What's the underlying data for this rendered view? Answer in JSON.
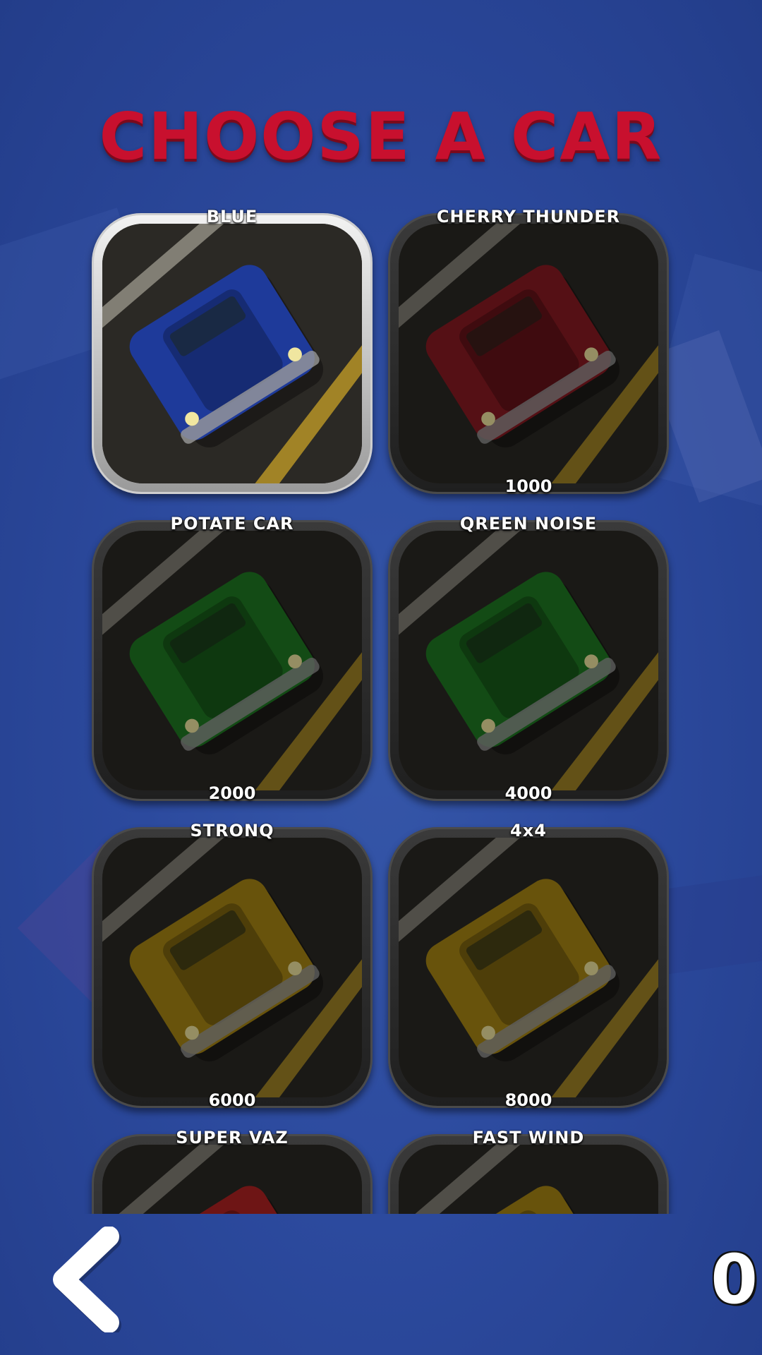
{
  "title": "CHOOSE A CAR",
  "cars": [
    {
      "name": "BLUE",
      "price": "",
      "color": "#1e3a9a",
      "selected": true
    },
    {
      "name": "CHERRY THUNDER",
      "price": "1000",
      "color": "#8a1a22",
      "selected": false
    },
    {
      "name": "POTATE CAR",
      "price": "2000",
      "color": "#1f7a22",
      "selected": false
    },
    {
      "name": "QREEN NOISE",
      "price": "4000",
      "color": "#1f7a22",
      "selected": false
    },
    {
      "name": "STRONQ",
      "price": "6000",
      "color": "#a88614",
      "selected": false
    },
    {
      "name": "4x4",
      "price": "8000",
      "color": "#a88614",
      "selected": false
    },
    {
      "name": "SUPER VAZ",
      "price": "",
      "color": "#b22222",
      "selected": false
    },
    {
      "name": "FAST WIND",
      "price": "",
      "color": "#a88614",
      "selected": false
    }
  ],
  "coins": "0",
  "back_icon": "chevron-left-icon"
}
